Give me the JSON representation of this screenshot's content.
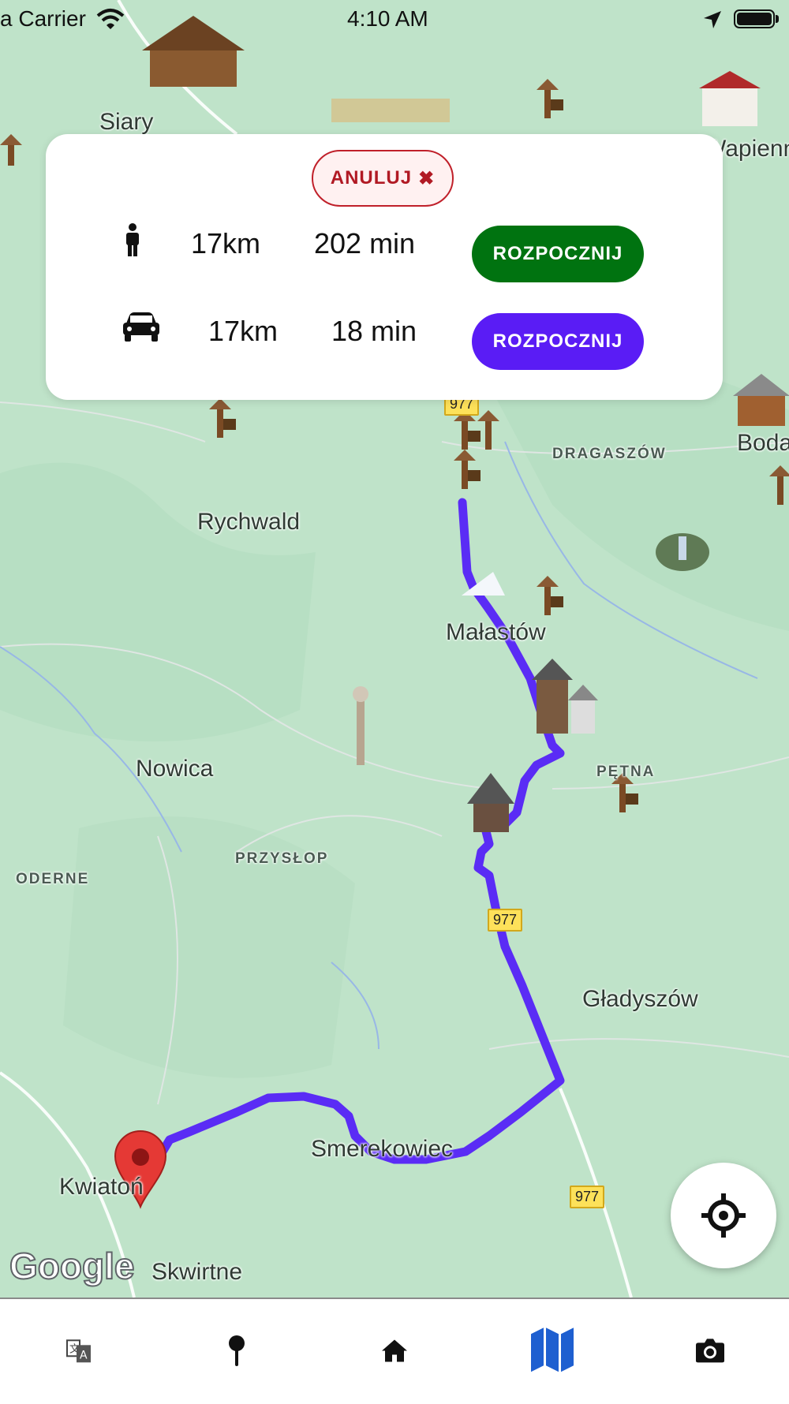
{
  "status_bar": {
    "carrier": "a Carrier",
    "time": "4:10 AM"
  },
  "map": {
    "towns": [
      {
        "key": "siary",
        "name": "Siary"
      },
      {
        "key": "wapienne",
        "name": "Wapienn"
      },
      {
        "key": "bodaki",
        "name": "Boda"
      },
      {
        "key": "rychwald",
        "name": "Rychwald"
      },
      {
        "key": "malastow",
        "name": "Małastów"
      },
      {
        "key": "nowica",
        "name": "Nowica"
      },
      {
        "key": "gladyszow",
        "name": "Gładyszów"
      },
      {
        "key": "smerekowiec",
        "name": "Smerekowiec"
      },
      {
        "key": "kwiaton",
        "name": "Kwiatoń"
      },
      {
        "key": "skwirtne",
        "name": "Skwirtne"
      }
    ],
    "hamlets": [
      {
        "key": "dragaszow",
        "name": "DRAGASZÓW"
      },
      {
        "key": "petna",
        "name": "PĘTNA"
      },
      {
        "key": "przyslop",
        "name": "PRZYSŁOP"
      },
      {
        "key": "oderne",
        "name": "ODERNE"
      }
    ],
    "road_shields": [
      "977",
      "977",
      "977"
    ],
    "attribution": "Google",
    "route_color": "#5a2cf5"
  },
  "route_card": {
    "cancel_label": "ANULUJ",
    "walk": {
      "icon": "person-walking-icon",
      "distance": "17km",
      "duration": "202 min",
      "button": "ROZPOCZNIJ",
      "color": "#007310"
    },
    "car": {
      "icon": "car-icon",
      "distance": "17km",
      "duration": "18 min",
      "button": "ROZPOCZNIJ",
      "color": "#5a1cf5"
    }
  },
  "tabbar": {
    "items": [
      {
        "icon": "translate-icon",
        "active": false
      },
      {
        "icon": "map-pin-icon",
        "active": false
      },
      {
        "icon": "home-icon",
        "active": false
      },
      {
        "icon": "map-icon",
        "active": true
      },
      {
        "icon": "camera-icon",
        "active": false
      }
    ],
    "active_color": "#1e5fd0"
  }
}
